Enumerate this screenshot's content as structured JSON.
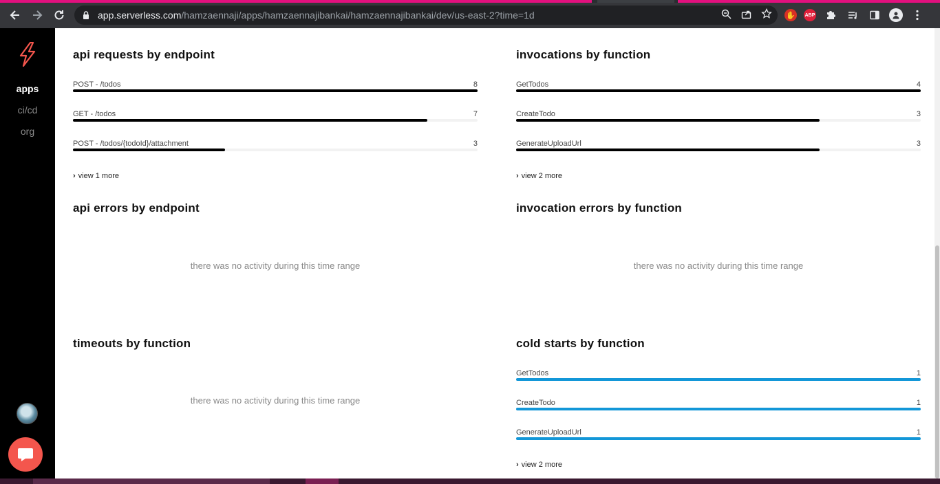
{
  "browser": {
    "url_host": "app.serverless.com",
    "url_path": "/hamzaennaji/apps/hamzaennajibankai/hamzaennajibankai/dev/us-east-2?time=1d",
    "ext_abp": "ABP"
  },
  "sidebar": {
    "items": [
      {
        "label": "apps",
        "active": true
      },
      {
        "label": "ci/cd",
        "active": false
      },
      {
        "label": "org",
        "active": false
      }
    ]
  },
  "panels": {
    "api_requests": {
      "title": "api requests by endpoint",
      "max": 8,
      "rows": [
        {
          "label": "POST - /todos",
          "value": 8
        },
        {
          "label": "GET - /todos",
          "value": 7
        },
        {
          "label": "POST - /todos/{todoId}/attachment",
          "value": 3
        }
      ],
      "more": "view 1 more"
    },
    "invocations": {
      "title": "invocations by function",
      "max": 4,
      "rows": [
        {
          "label": "GetTodos",
          "value": 4
        },
        {
          "label": "CreateTodo",
          "value": 3
        },
        {
          "label": "GenerateUploadUrl",
          "value": 3
        }
      ],
      "more": "view 2 more"
    },
    "api_errors": {
      "title": "api errors by endpoint",
      "empty": "there was no activity during this time range"
    },
    "invocation_errors": {
      "title": "invocation errors by function",
      "empty": "there was no activity during this time range"
    },
    "timeouts": {
      "title": "timeouts by function",
      "empty": "there was no activity during this time range"
    },
    "cold_starts": {
      "title": "cold starts by function",
      "max": 1,
      "rows": [
        {
          "label": "GetTodos",
          "value": 1
        },
        {
          "label": "CreateTodo",
          "value": 1
        },
        {
          "label": "GenerateUploadUrl",
          "value": 1
        }
      ],
      "more": "view 2 more"
    }
  },
  "colors": {
    "bar_default": "#000000",
    "bar_cold_starts": "#1397d8",
    "accent": "#f4564d"
  }
}
